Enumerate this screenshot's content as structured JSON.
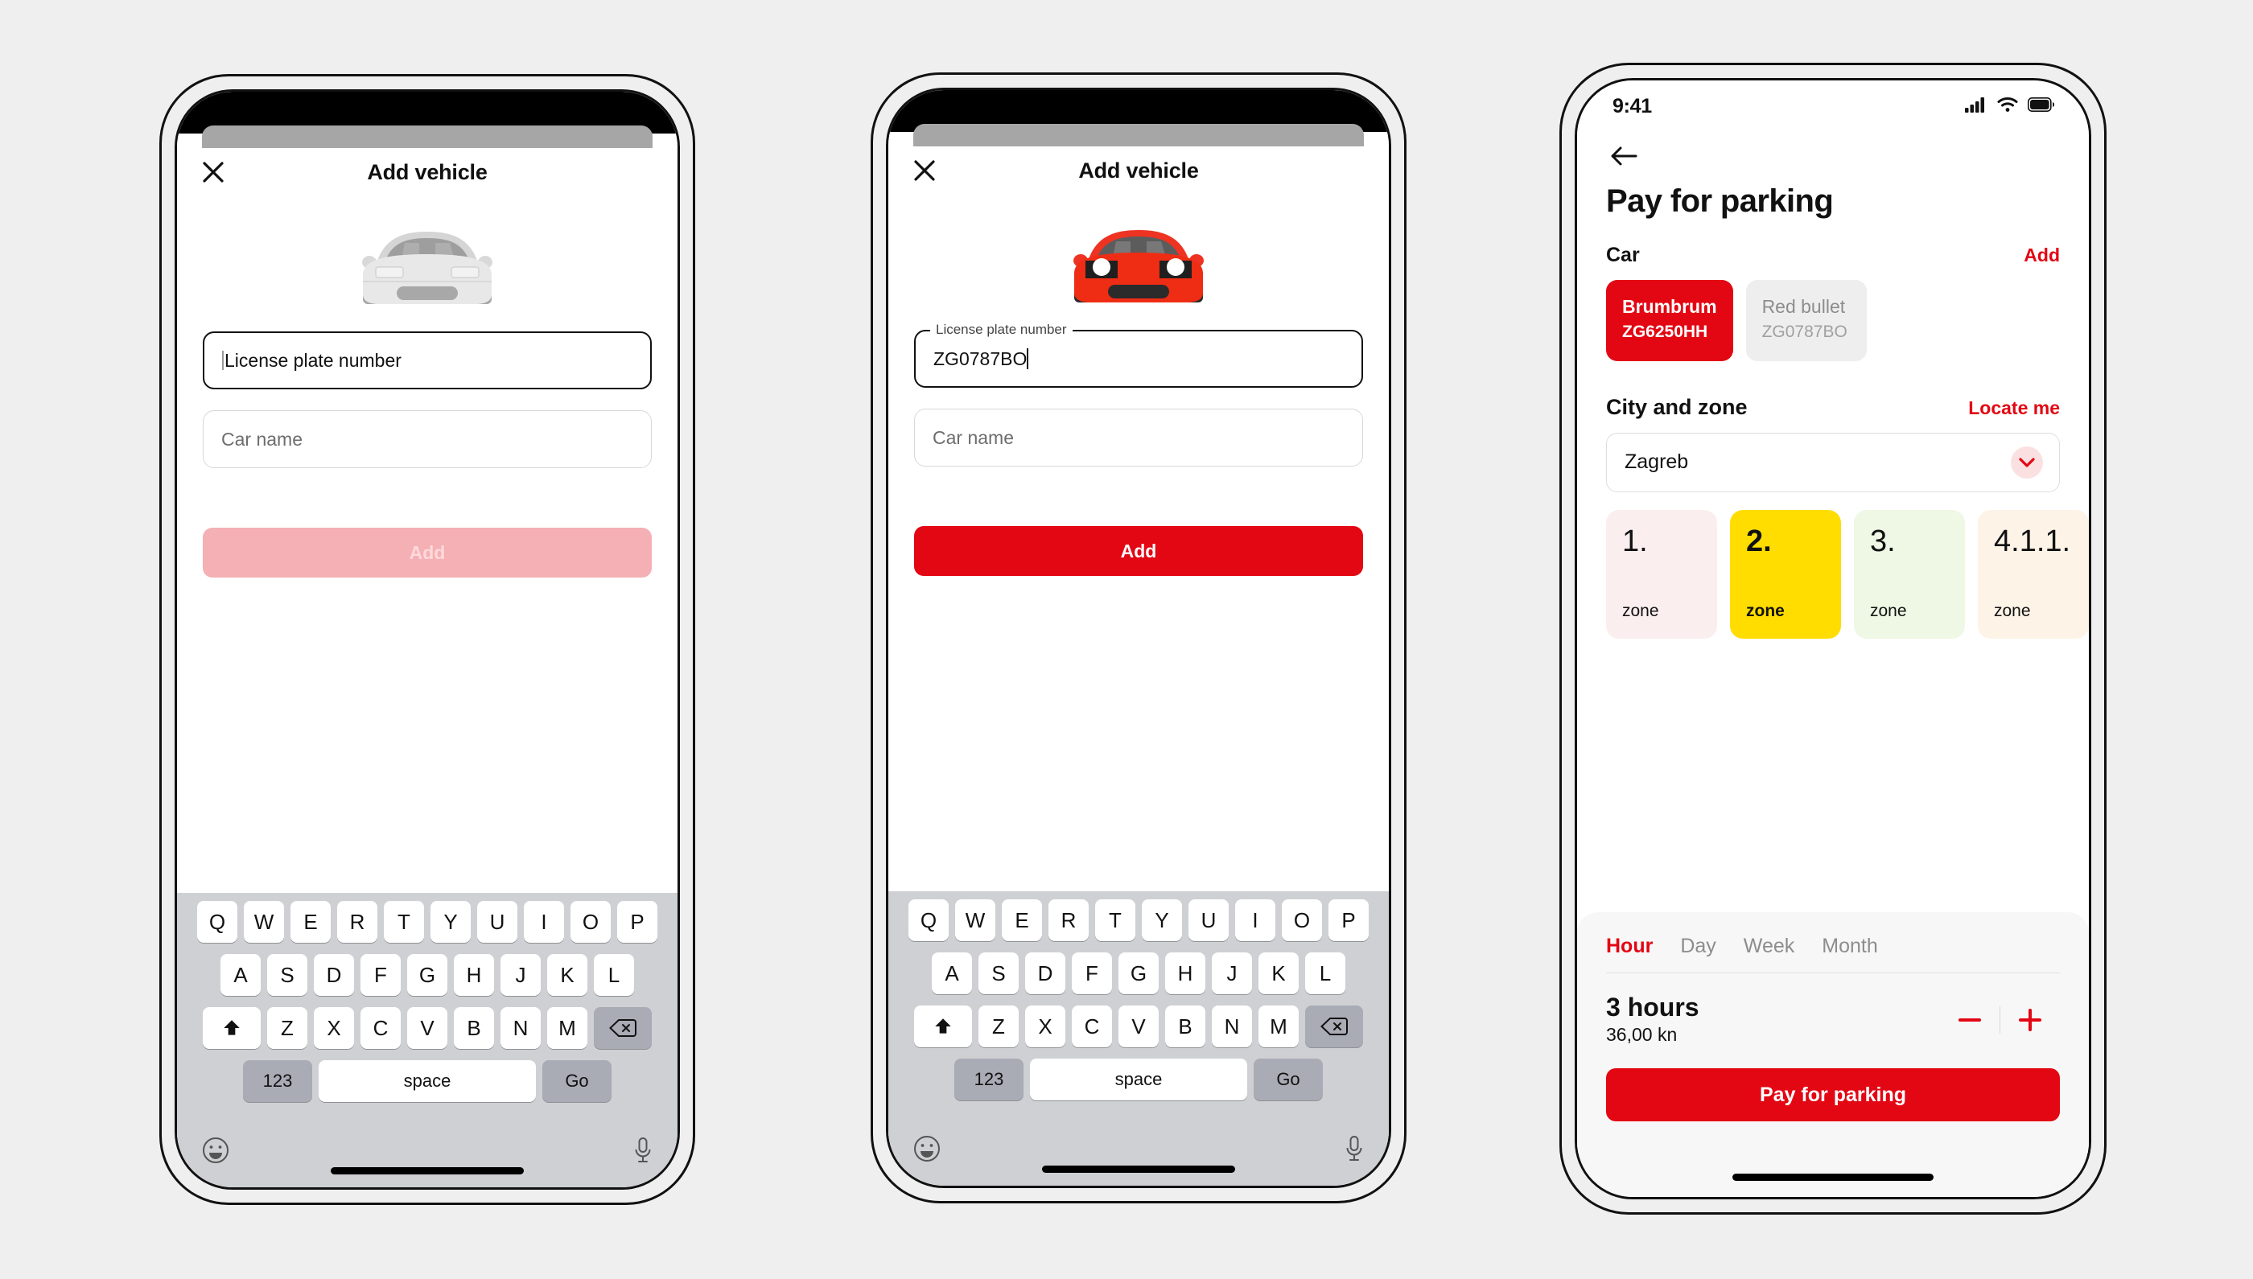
{
  "screens": {
    "add_vehicle_empty": {
      "title": "Add vehicle",
      "close_icon": "close-icon",
      "car_illustration": "car-front-grey-icon",
      "plate_field": {
        "placeholder": "License plate number",
        "value": "",
        "focused": true
      },
      "name_field": {
        "placeholder": "Car name",
        "value": ""
      },
      "submit_label": "Add",
      "submit_enabled": false
    },
    "add_vehicle_filled": {
      "title": "Add vehicle",
      "close_icon": "close-icon",
      "car_illustration": "car-front-red-icon",
      "plate_field": {
        "label": "License plate number",
        "placeholder": "License plate number",
        "value": "ZG0787BO",
        "focused": true
      },
      "name_field": {
        "placeholder": "Car name",
        "value": ""
      },
      "submit_label": "Add",
      "submit_enabled": true
    },
    "pay_for_parking": {
      "statusbar": {
        "time": "9:41",
        "cellular_icon": "signal-bars-icon",
        "wifi_icon": "wifi-icon",
        "battery_icon": "battery-full-icon"
      },
      "back_icon": "arrow-left-icon",
      "page_title": "Pay for parking",
      "car_section": {
        "title": "Car",
        "action_label": "Add",
        "cars": [
          {
            "name": "Brumbrum",
            "plate": "ZG6250HH",
            "selected": true
          },
          {
            "name": "Red bullet",
            "plate": "ZG0787BO",
            "selected": false
          }
        ]
      },
      "city_section": {
        "title": "City and zone",
        "action_label": "Locate me",
        "city_value": "Zagreb",
        "caret_icon": "chevron-down-icon",
        "zones": [
          {
            "number": "1.",
            "label": "zone",
            "color": "#fbeeee",
            "selected": false
          },
          {
            "number": "2.",
            "label": "zone",
            "color": "#ffdd00",
            "selected": true
          },
          {
            "number": "3.",
            "label": "zone",
            "color": "#eef8e4",
            "selected": false
          },
          {
            "number": "4.1.1.",
            "label": "zone",
            "color": "#fdf3e6",
            "selected": false
          }
        ]
      },
      "duration_card": {
        "tabs": [
          {
            "label": "Hour",
            "active": true
          },
          {
            "label": "Day",
            "active": false
          },
          {
            "label": "Week",
            "active": false
          },
          {
            "label": "Month",
            "active": false
          }
        ],
        "duration_value": "3 hours",
        "price": "36,00 kn",
        "minus_icon": "minus-icon",
        "plus_icon": "plus-icon",
        "pay_label": "Pay for parking"
      }
    }
  },
  "keyboard": {
    "row1": [
      "Q",
      "W",
      "E",
      "R",
      "T",
      "Y",
      "U",
      "I",
      "O",
      "P"
    ],
    "row2": [
      "A",
      "S",
      "D",
      "F",
      "G",
      "H",
      "J",
      "K",
      "L"
    ],
    "row3": [
      "Z",
      "X",
      "C",
      "V",
      "B",
      "N",
      "M"
    ],
    "shift_icon": "shift-up-icon",
    "backspace_icon": "backspace-icon",
    "numeric_label": "123",
    "space_label": "space",
    "return_label": "Go",
    "emoji_icon": "emoji-smiley-icon",
    "mic_icon": "microphone-icon"
  },
  "colors": {
    "brand_red": "#e30613",
    "disabled_red": "#f4b0b4",
    "zone_yellow": "#ffdd00",
    "page_bg": "#efefef"
  }
}
